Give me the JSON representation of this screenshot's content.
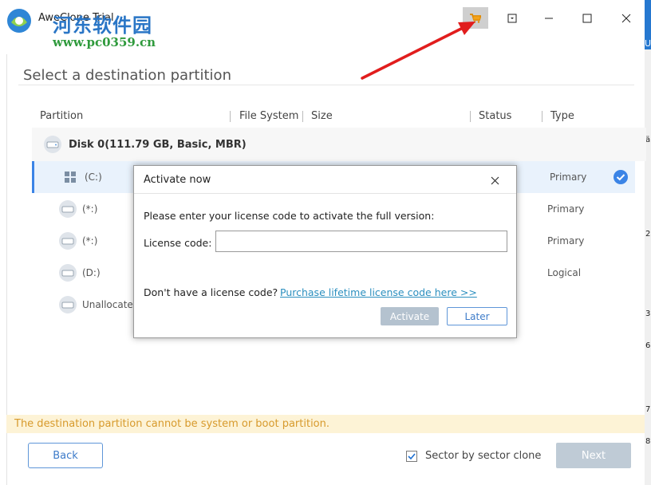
{
  "window": {
    "title": "AweClone Trial",
    "watermark_cn": "河东软件园",
    "watermark_url": "www.pc0359.cn"
  },
  "page": {
    "heading": "Select a destination partition"
  },
  "table": {
    "columns": [
      "Partition",
      "File System",
      "Size",
      "Status",
      "Type"
    ],
    "disk": "Disk 0(111.79 GB, Basic, MBR)",
    "rows": [
      {
        "name": "(C:)",
        "type": "Primary",
        "selected": true
      },
      {
        "name": "(*:)",
        "type": "Primary",
        "selected": false
      },
      {
        "name": "(*:)",
        "type": "Primary",
        "selected": false
      },
      {
        "name": "(D:)",
        "type": "Logical",
        "selected": false
      },
      {
        "name": "Unallocated",
        "type": "",
        "selected": false
      }
    ]
  },
  "warning": "The destination partition cannot be system or boot partition.",
  "footer": {
    "back_label": "Back",
    "sector_label": "Sector by sector clone",
    "sector_checked": true,
    "next_label": "Next"
  },
  "modal": {
    "title": "Activate now",
    "prompt": "Please enter your license code to activate the full version:",
    "license_label": "License code:",
    "license_value": "",
    "no_license": "Don't have a license code?",
    "purchase_link": "Purchase lifetime license code here >>",
    "activate_label": "Activate",
    "later_label": "Later"
  },
  "colors": {
    "accent": "#3b84e6",
    "warning_bg": "#fdf3d6",
    "warning_text": "#d79a2c",
    "arrow": "#e11d1d"
  },
  "right_edge_glyphs": [
    "U",
    "ä",
    "2",
    "3",
    "6",
    "7",
    "8"
  ]
}
